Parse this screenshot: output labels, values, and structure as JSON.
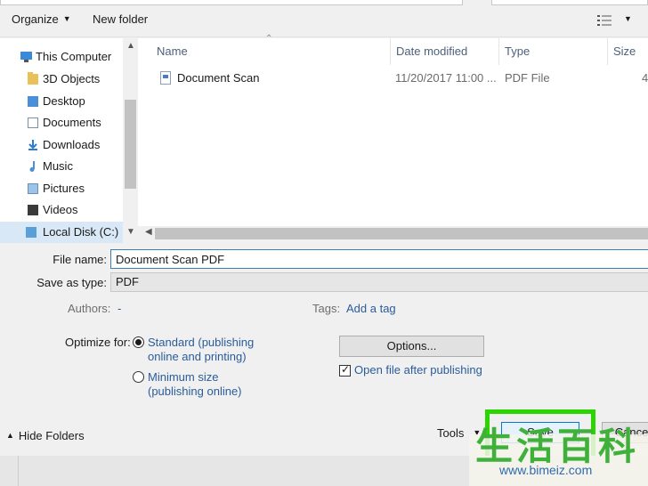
{
  "toolbar": {
    "organize": "Organize",
    "new_folder": "New folder"
  },
  "nav": {
    "items": [
      {
        "label": "This Computer",
        "icon": "computer-icon"
      },
      {
        "label": "3D Objects",
        "icon": "folder-icon"
      },
      {
        "label": "Desktop",
        "icon": "folder-icon"
      },
      {
        "label": "Documents",
        "icon": "folder-icon"
      },
      {
        "label": "Downloads",
        "icon": "folder-icon"
      },
      {
        "label": "Music",
        "icon": "folder-icon"
      },
      {
        "label": "Pictures",
        "icon": "folder-icon"
      },
      {
        "label": "Videos",
        "icon": "folder-icon"
      },
      {
        "label": "Local Disk (C:)",
        "icon": "disk-icon"
      }
    ]
  },
  "file_list": {
    "columns": [
      "Name",
      "Date modified",
      "Type",
      "Size"
    ],
    "rows": [
      {
        "name": "Document Scan",
        "date": "11/20/2017 11:00 ...",
        "type": "PDF File",
        "size": "4"
      }
    ]
  },
  "form": {
    "file_name_label": "File name:",
    "file_name_value": "Document Scan PDF",
    "save_as_type_label": "Save as type:",
    "save_as_type_value": "PDF",
    "authors_label": "Authors:",
    "authors_value": "-",
    "tags_label": "Tags:",
    "tags_value": "Add a tag",
    "optimize_label": "Optimize for:",
    "standard_line1": "Standard (publishing",
    "standard_line2": "online and printing)",
    "minimum_line1": "Minimum size",
    "minimum_line2": "(publishing online)",
    "options_button": "Options...",
    "open_after_label": "Open file after publishing"
  },
  "footer": {
    "hide_folders": "Hide Folders",
    "tools": "Tools",
    "save": "Save",
    "cancel": "Cancel"
  },
  "watermark": {
    "chars": "生活百科",
    "url": "www.bimeiz.com"
  },
  "colors": {
    "highlight": "#2bd600",
    "link": "#2a5c9a",
    "selection": "#d9e8f6"
  }
}
